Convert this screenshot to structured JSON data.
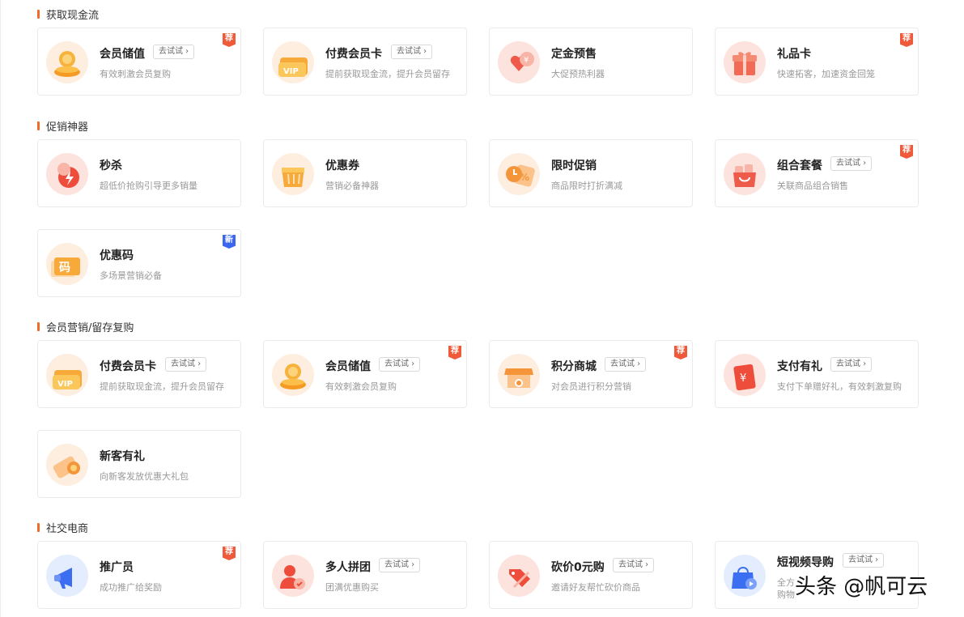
{
  "sections": [
    {
      "title": "获取现金流",
      "cards": [
        {
          "title": "会员储值",
          "try": "去试试",
          "desc": "有效刺激会员复购",
          "badge": "荐",
          "badge_type": "rec",
          "icon": "coin-stack-icon"
        },
        {
          "title": "付费会员卡",
          "try": "去试试",
          "desc": "提前获取现金流，提升会员留存",
          "badge": "",
          "badge_type": "",
          "icon": "vip-card-icon"
        },
        {
          "title": "定金预售",
          "try": "",
          "desc": "大促预热利器",
          "badge": "",
          "badge_type": "",
          "icon": "deposit-heart-icon"
        },
        {
          "title": "礼品卡",
          "try": "",
          "desc": "快速拓客，加速资金回笼",
          "badge": "荐",
          "badge_type": "rec",
          "icon": "gift-box-icon"
        }
      ]
    },
    {
      "title": "促销神器",
      "cards": [
        {
          "title": "秒杀",
          "try": "",
          "desc": "超低价抢购引导更多销量",
          "badge": "",
          "badge_type": "",
          "icon": "flash-sale-icon"
        },
        {
          "title": "优惠券",
          "try": "",
          "desc": "营销必备神器",
          "badge": "",
          "badge_type": "",
          "icon": "coupon-icon"
        },
        {
          "title": "限时促销",
          "try": "",
          "desc": "商品限时打折满减",
          "badge": "",
          "badge_type": "",
          "icon": "discount-clock-icon"
        },
        {
          "title": "组合套餐",
          "try": "去试试",
          "desc": "关联商品组合销售",
          "badge": "荐",
          "badge_type": "rec",
          "icon": "shopping-bag-icon"
        },
        {
          "title": "优惠码",
          "try": "",
          "desc": "多场景营销必备",
          "badge": "新",
          "badge_type": "new",
          "icon": "promo-code-icon",
          "icon_text": "码"
        }
      ]
    },
    {
      "title": "会员营销/留存复购",
      "cards": [
        {
          "title": "付费会员卡",
          "try": "去试试",
          "desc": "提前获取现金流，提升会员留存",
          "badge": "",
          "badge_type": "",
          "icon": "vip-card-icon"
        },
        {
          "title": "会员储值",
          "try": "去试试",
          "desc": "有效刺激会员复购",
          "badge": "荐",
          "badge_type": "rec",
          "icon": "coin-stack-icon"
        },
        {
          "title": "积分商城",
          "try": "去试试",
          "desc": "对会员进行积分营销",
          "badge": "荐",
          "badge_type": "rec",
          "icon": "points-store-icon"
        },
        {
          "title": "支付有礼",
          "try": "去试试",
          "desc": "支付下单赠好礼，有效刺激复购",
          "badge": "",
          "badge_type": "",
          "icon": "payment-gift-icon"
        },
        {
          "title": "新客有礼",
          "try": "",
          "desc": "向新客发放优惠大礼包",
          "badge": "",
          "badge_type": "",
          "icon": "new-customer-gift-icon"
        }
      ]
    },
    {
      "title": "社交电商",
      "cards": [
        {
          "title": "推广员",
          "try": "",
          "desc": "成功推广给奖励",
          "badge": "荐",
          "badge_type": "rec",
          "icon": "megaphone-icon"
        },
        {
          "title": "多人拼团",
          "try": "去试试",
          "desc": "团满优惠购买",
          "badge": "",
          "badge_type": "",
          "icon": "group-buy-icon"
        },
        {
          "title": "砍价0元购",
          "try": "去试试",
          "desc": "邀请好友帮忙砍价商品",
          "badge": "",
          "badge_type": "",
          "icon": "bargain-tag-icon"
        },
        {
          "title": "短视频导购",
          "try": "去试试",
          "desc": "全方",
          "desc2": "购物",
          "badge": "",
          "badge_type": "",
          "icon": "video-shopping-icon"
        }
      ]
    }
  ],
  "watermark": "头条 @帆可云",
  "colors": {
    "accent": "#f26b2b",
    "badge_rec": "#ef5a3a",
    "badge_new": "#3b66f0"
  }
}
